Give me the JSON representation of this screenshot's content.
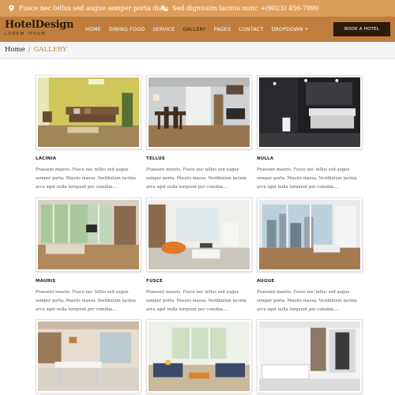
{
  "topbar": {
    "address": "Fusce nec tellus sed augue semper porta diam",
    "phone": "Sed dignissim lacinia nunc +(9023) 456-7890",
    "address_icon": "map-pin-icon",
    "phone_icon": "phone-icon"
  },
  "header": {
    "logo_name": "HotelDesign",
    "logo_tagline": "LOREM IPSUM",
    "nav": [
      "HOME",
      "DINING FOOD",
      "SERVICE",
      "GALLERY",
      "PAGES",
      "CONTACT",
      "DROPDOWN"
    ],
    "active_nav": "GALLERY",
    "book_button": "BOOK A HOTEL"
  },
  "breadcrumb": {
    "home": "Home",
    "separator": "/",
    "current": "GALLERY"
  },
  "gallery": [
    {
      "title": "LACINIA",
      "desc": "Praesent mauris. Fusce nec tellus sed augue semper porta. Mauris massa. Vestibulum lacinia arcu eget nulla torquent per conubia...."
    },
    {
      "title": "TELLUS",
      "desc": "Praesent mauris. Fusce nec tellus sed augue semper porta. Mauris massa. Vestibulum lacinia arcu eget nulla torquent per conubia...."
    },
    {
      "title": "NULLA",
      "desc": "Praesent mauris. Fusce nec tellus sed augue semper porta. Mauris massa. Vestibulum lacinia arcu eget nulla torquent per conubia...."
    },
    {
      "title": "MAURIS",
      "desc": "Praesent mauris. Fusce nec tellus sed augue semper porta. Mauris massa. Vestibulum lacinia arcu eget nulla torquent per conubia...."
    },
    {
      "title": "FUSCE",
      "desc": "Praesent mauris. Fusce nec tellus sed augue semper porta. Mauris massa. Vestibulum lacinia arcu eget nulla torquent per conubia...."
    },
    {
      "title": "AUGUE",
      "desc": "Praesent mauris. Fusce nec tellus sed augue semper porta. Mauris massa. Vestibulum lacinia arcu eget nulla torquent per conubia...."
    },
    {
      "title": "",
      "desc": ""
    },
    {
      "title": "",
      "desc": ""
    },
    {
      "title": "",
      "desc": ""
    }
  ],
  "colors": {
    "topbar": "#dd9e5b",
    "header": "#c07e3e",
    "accent": "#c98a47",
    "button": "#2d1b0d"
  }
}
